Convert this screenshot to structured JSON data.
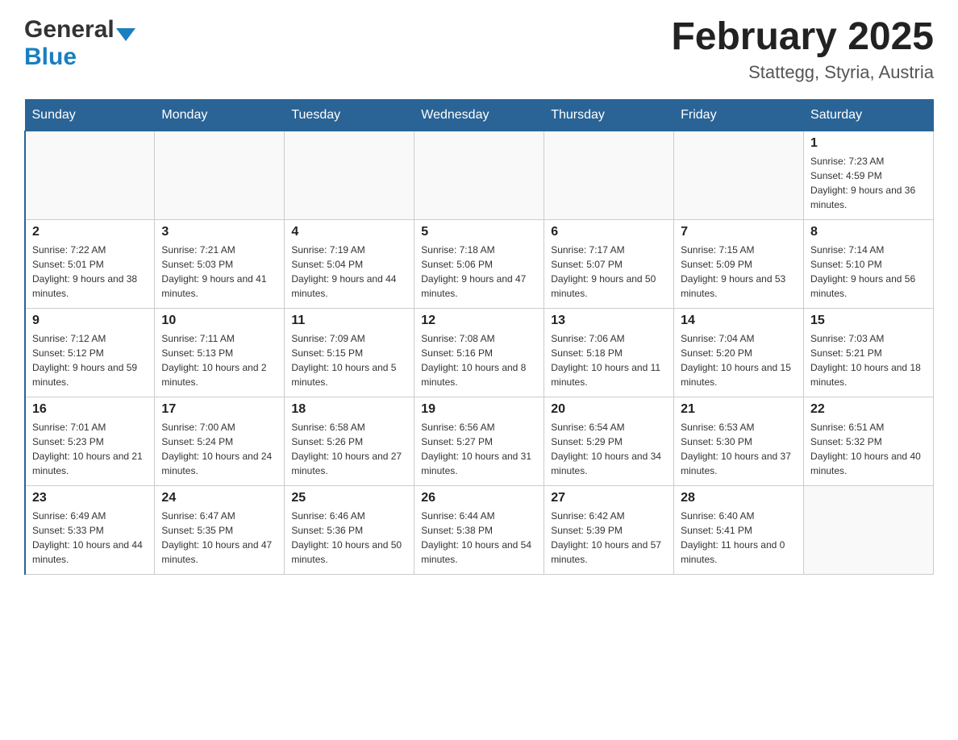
{
  "header": {
    "logo_general": "General",
    "logo_blue": "Blue",
    "month_title": "February 2025",
    "location": "Stattegg, Styria, Austria"
  },
  "weekdays": [
    "Sunday",
    "Monday",
    "Tuesday",
    "Wednesday",
    "Thursday",
    "Friday",
    "Saturday"
  ],
  "weeks": [
    [
      {
        "day": "",
        "sunrise": "",
        "sunset": "",
        "daylight": ""
      },
      {
        "day": "",
        "sunrise": "",
        "sunset": "",
        "daylight": ""
      },
      {
        "day": "",
        "sunrise": "",
        "sunset": "",
        "daylight": ""
      },
      {
        "day": "",
        "sunrise": "",
        "sunset": "",
        "daylight": ""
      },
      {
        "day": "",
        "sunrise": "",
        "sunset": "",
        "daylight": ""
      },
      {
        "day": "",
        "sunrise": "",
        "sunset": "",
        "daylight": ""
      },
      {
        "day": "1",
        "sunrise": "Sunrise: 7:23 AM",
        "sunset": "Sunset: 4:59 PM",
        "daylight": "Daylight: 9 hours and 36 minutes."
      }
    ],
    [
      {
        "day": "2",
        "sunrise": "Sunrise: 7:22 AM",
        "sunset": "Sunset: 5:01 PM",
        "daylight": "Daylight: 9 hours and 38 minutes."
      },
      {
        "day": "3",
        "sunrise": "Sunrise: 7:21 AM",
        "sunset": "Sunset: 5:03 PM",
        "daylight": "Daylight: 9 hours and 41 minutes."
      },
      {
        "day": "4",
        "sunrise": "Sunrise: 7:19 AM",
        "sunset": "Sunset: 5:04 PM",
        "daylight": "Daylight: 9 hours and 44 minutes."
      },
      {
        "day": "5",
        "sunrise": "Sunrise: 7:18 AM",
        "sunset": "Sunset: 5:06 PM",
        "daylight": "Daylight: 9 hours and 47 minutes."
      },
      {
        "day": "6",
        "sunrise": "Sunrise: 7:17 AM",
        "sunset": "Sunset: 5:07 PM",
        "daylight": "Daylight: 9 hours and 50 minutes."
      },
      {
        "day": "7",
        "sunrise": "Sunrise: 7:15 AM",
        "sunset": "Sunset: 5:09 PM",
        "daylight": "Daylight: 9 hours and 53 minutes."
      },
      {
        "day": "8",
        "sunrise": "Sunrise: 7:14 AM",
        "sunset": "Sunset: 5:10 PM",
        "daylight": "Daylight: 9 hours and 56 minutes."
      }
    ],
    [
      {
        "day": "9",
        "sunrise": "Sunrise: 7:12 AM",
        "sunset": "Sunset: 5:12 PM",
        "daylight": "Daylight: 9 hours and 59 minutes."
      },
      {
        "day": "10",
        "sunrise": "Sunrise: 7:11 AM",
        "sunset": "Sunset: 5:13 PM",
        "daylight": "Daylight: 10 hours and 2 minutes."
      },
      {
        "day": "11",
        "sunrise": "Sunrise: 7:09 AM",
        "sunset": "Sunset: 5:15 PM",
        "daylight": "Daylight: 10 hours and 5 minutes."
      },
      {
        "day": "12",
        "sunrise": "Sunrise: 7:08 AM",
        "sunset": "Sunset: 5:16 PM",
        "daylight": "Daylight: 10 hours and 8 minutes."
      },
      {
        "day": "13",
        "sunrise": "Sunrise: 7:06 AM",
        "sunset": "Sunset: 5:18 PM",
        "daylight": "Daylight: 10 hours and 11 minutes."
      },
      {
        "day": "14",
        "sunrise": "Sunrise: 7:04 AM",
        "sunset": "Sunset: 5:20 PM",
        "daylight": "Daylight: 10 hours and 15 minutes."
      },
      {
        "day": "15",
        "sunrise": "Sunrise: 7:03 AM",
        "sunset": "Sunset: 5:21 PM",
        "daylight": "Daylight: 10 hours and 18 minutes."
      }
    ],
    [
      {
        "day": "16",
        "sunrise": "Sunrise: 7:01 AM",
        "sunset": "Sunset: 5:23 PM",
        "daylight": "Daylight: 10 hours and 21 minutes."
      },
      {
        "day": "17",
        "sunrise": "Sunrise: 7:00 AM",
        "sunset": "Sunset: 5:24 PM",
        "daylight": "Daylight: 10 hours and 24 minutes."
      },
      {
        "day": "18",
        "sunrise": "Sunrise: 6:58 AM",
        "sunset": "Sunset: 5:26 PM",
        "daylight": "Daylight: 10 hours and 27 minutes."
      },
      {
        "day": "19",
        "sunrise": "Sunrise: 6:56 AM",
        "sunset": "Sunset: 5:27 PM",
        "daylight": "Daylight: 10 hours and 31 minutes."
      },
      {
        "day": "20",
        "sunrise": "Sunrise: 6:54 AM",
        "sunset": "Sunset: 5:29 PM",
        "daylight": "Daylight: 10 hours and 34 minutes."
      },
      {
        "day": "21",
        "sunrise": "Sunrise: 6:53 AM",
        "sunset": "Sunset: 5:30 PM",
        "daylight": "Daylight: 10 hours and 37 minutes."
      },
      {
        "day": "22",
        "sunrise": "Sunrise: 6:51 AM",
        "sunset": "Sunset: 5:32 PM",
        "daylight": "Daylight: 10 hours and 40 minutes."
      }
    ],
    [
      {
        "day": "23",
        "sunrise": "Sunrise: 6:49 AM",
        "sunset": "Sunset: 5:33 PM",
        "daylight": "Daylight: 10 hours and 44 minutes."
      },
      {
        "day": "24",
        "sunrise": "Sunrise: 6:47 AM",
        "sunset": "Sunset: 5:35 PM",
        "daylight": "Daylight: 10 hours and 47 minutes."
      },
      {
        "day": "25",
        "sunrise": "Sunrise: 6:46 AM",
        "sunset": "Sunset: 5:36 PM",
        "daylight": "Daylight: 10 hours and 50 minutes."
      },
      {
        "day": "26",
        "sunrise": "Sunrise: 6:44 AM",
        "sunset": "Sunset: 5:38 PM",
        "daylight": "Daylight: 10 hours and 54 minutes."
      },
      {
        "day": "27",
        "sunrise": "Sunrise: 6:42 AM",
        "sunset": "Sunset: 5:39 PM",
        "daylight": "Daylight: 10 hours and 57 minutes."
      },
      {
        "day": "28",
        "sunrise": "Sunrise: 6:40 AM",
        "sunset": "Sunset: 5:41 PM",
        "daylight": "Daylight: 11 hours and 0 minutes."
      },
      {
        "day": "",
        "sunrise": "",
        "sunset": "",
        "daylight": ""
      }
    ]
  ]
}
